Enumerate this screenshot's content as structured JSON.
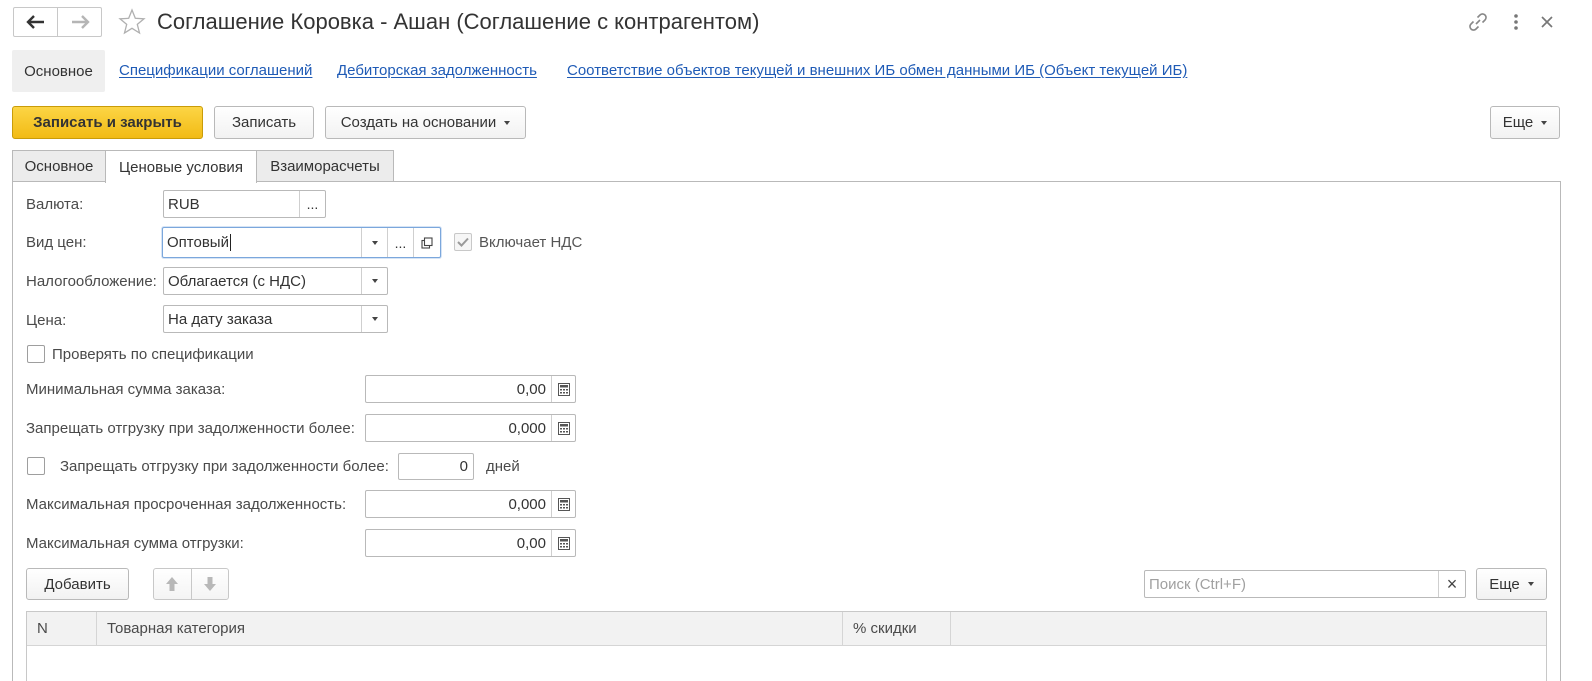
{
  "window": {
    "title": "Соглашение Коровка - Ашан (Соглашение с контрагентом)"
  },
  "top_nav": {
    "active": "Основное",
    "links": [
      "Спецификации соглашений",
      "Дебиторская задолженность",
      "Соответствие объектов текущей и внешних ИБ обмен данными ИБ (Объект текущей ИБ)"
    ]
  },
  "toolbar": {
    "save_close": "Записать и закрыть",
    "save": "Записать",
    "create_based": "Создать на основании",
    "more": "Еще"
  },
  "tabs": [
    "Основное",
    "Ценовые условия",
    "Взаиморасчеты"
  ],
  "active_tab": "Ценовые условия",
  "form": {
    "currency_label": "Валюта:",
    "currency_value": "RUB",
    "select_glyph": "...",
    "price_type_label": "Вид цен:",
    "price_type_value": "Оптовый",
    "includes_vat_label": "Включает НДС",
    "includes_vat_checked": true,
    "taxation_label": "Налогообложение:",
    "taxation_value": "Облагается (с НДС)",
    "price_label": "Цена:",
    "price_value": "На дату заказа",
    "check_spec_label": "Проверять по спецификации",
    "check_spec_checked": false,
    "min_order_label": "Минимальная сумма заказа:",
    "min_order_value": "0,00",
    "block_debt_amount_label": "Запрещать отгрузку при задолженности более:",
    "block_debt_amount_value": "0,000",
    "block_debt_days_label": "Запрещать отгрузку при задолженности более:",
    "block_debt_days_checked": false,
    "block_debt_days_value": "0",
    "days_label": "дней",
    "max_overdue_label": "Максимальная просроченная задолженность:",
    "max_overdue_value": "0,000",
    "max_shipment_label": "Максимальная сумма отгрузки:",
    "max_shipment_value": "0,00"
  },
  "table_toolbar": {
    "add": "Добавить",
    "search_placeholder": "Поиск (Ctrl+F)",
    "clear_glyph": "×",
    "more": "Еще"
  },
  "table": {
    "columns": [
      "N",
      "Товарная категория",
      "% скидки"
    ]
  },
  "colors": {
    "accent_yellow": "#f5c52a",
    "link_blue": "#1f5bb6",
    "border": "#b9b9b9",
    "focus_border": "#7ba7dc"
  }
}
